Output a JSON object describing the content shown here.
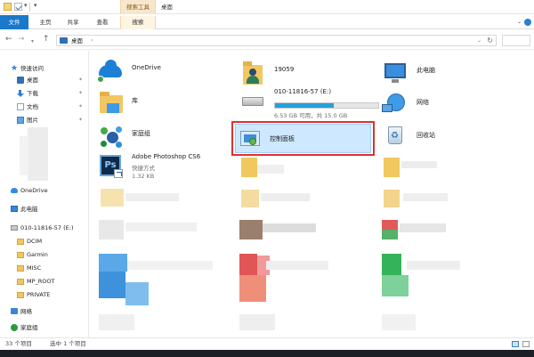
{
  "titlebar": {
    "context_group": "搜索工具",
    "window_title": "桌面"
  },
  "ribbon": {
    "tabs": [
      {
        "label": "文件",
        "active": true
      },
      {
        "label": "主页"
      },
      {
        "label": "共享"
      },
      {
        "label": "查看"
      },
      {
        "label": "搜索"
      }
    ]
  },
  "address": {
    "location": "桌面",
    "separator": "›"
  },
  "sidebar": {
    "quick_access": "快速访问",
    "pinned": [
      {
        "label": "桌面",
        "icon": "desktop-icon"
      },
      {
        "label": "下载",
        "icon": "download-icon"
      },
      {
        "label": "文档",
        "icon": "document-icon"
      },
      {
        "label": "图片",
        "icon": "picture-icon"
      }
    ],
    "onedrive": "OneDrive",
    "this_pc": "此电脑",
    "drive": "010-11816-57 (E:)",
    "drive_folders": [
      "DCIM",
      "Garmin",
      "MISC",
      "MP_ROOT",
      "PRIVATE"
    ],
    "network": "网络",
    "homegroup": "家庭组"
  },
  "items": {
    "onedrive": {
      "name": "OneDrive"
    },
    "library": {
      "name": "库"
    },
    "homegroup": {
      "name": "家庭组"
    },
    "photoshop": {
      "name": "Adobe Photoshop CS6",
      "type": "快捷方式",
      "size": "1.32 KB"
    },
    "user_folder": {
      "name": "19059"
    },
    "drive": {
      "name": "010-11816-57 (E:)",
      "space": "6.53 GB 可用，共 15.0 GB",
      "used_fraction": 0.565
    },
    "control_panel": {
      "name": "控制面板"
    },
    "this_pc": {
      "name": "此电脑"
    },
    "network": {
      "name": "网络"
    },
    "recycle_bin": {
      "name": "回收站"
    }
  },
  "status": {
    "count": "33 个项目",
    "selected": "选中 1 个项目"
  },
  "colors": {
    "accent": "#1979ca",
    "selection_fill": "#cde8ff",
    "highlight_border": "#e03030",
    "drive_bar": "#26a0da"
  }
}
